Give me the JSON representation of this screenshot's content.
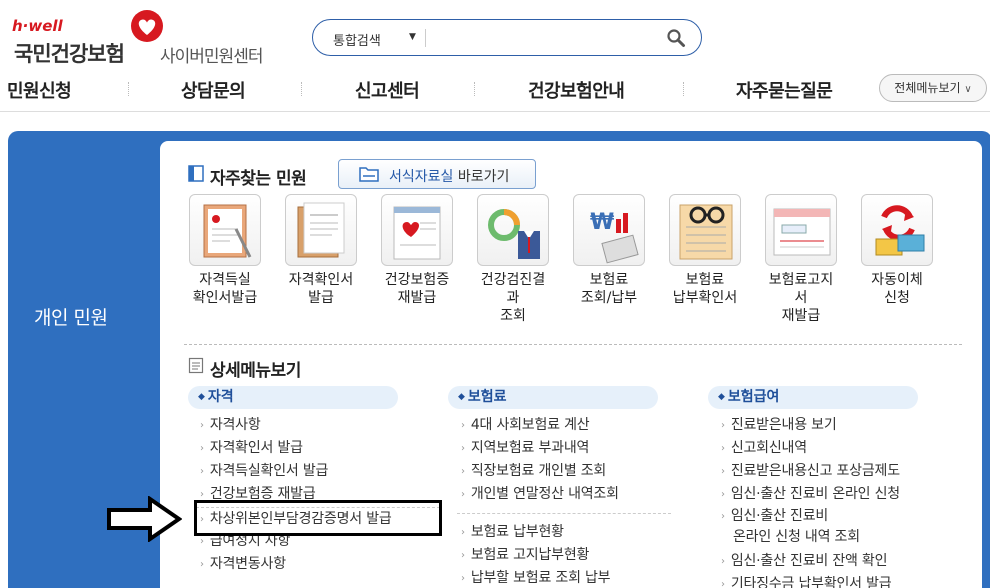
{
  "header": {
    "brand_hwell": "h·well",
    "brand_name": "국민건강보험",
    "brand_sub": "사이버민원센터",
    "search": {
      "scope": "통합검색",
      "value": ""
    }
  },
  "gnb": {
    "items": [
      "민원신청",
      "상담문의",
      "신고센터",
      "건강보험안내",
      "자주묻는질문"
    ],
    "all_menu": "전체메뉴보기"
  },
  "side_tab": {
    "label": "개인 민원"
  },
  "frequent": {
    "title": "자주찾는 민원",
    "form_button": {
      "highlight": "서식자료실",
      "rest": " 바로가기"
    },
    "tiles": [
      {
        "line1": "자격득실",
        "line2": "확인서발급",
        "line3": "",
        "icon": "document-pen-icon"
      },
      {
        "line1": "자격확인서",
        "line2": "발급",
        "line3": "",
        "icon": "clipboard-document-icon"
      },
      {
        "line1": "건강보험증",
        "line2": "재발급",
        "line3": "",
        "icon": "insurance-card-icon"
      },
      {
        "line1": "건강검진결",
        "line2": "과",
        "line3": "조회",
        "icon": "health-checkup-chart-icon"
      },
      {
        "line1": "보험료",
        "line2": "조회/납부",
        "line3": "",
        "icon": "won-chart-icon"
      },
      {
        "line1": "보험료",
        "line2": "납부확인서",
        "line3": "",
        "icon": "glasses-ledger-icon"
      },
      {
        "line1": "보험료고지",
        "line2": "서",
        "line3": "재발급",
        "icon": "bill-notice-icon"
      },
      {
        "line1": "자동이체",
        "line2": "신청",
        "line3": "",
        "icon": "auto-transfer-icon"
      }
    ]
  },
  "detail": {
    "title": "상세메뉴보기",
    "columns": [
      {
        "category": "자격",
        "links": [
          "자격사항",
          "자격확인서 발급",
          "자격득실확인서 발급",
          "건강보험증 재발급",
          "차상위본인부담경감증명서 발급",
          "급여정지 사항",
          "자격변동사항"
        ]
      },
      {
        "category": "보험료",
        "links": [
          "4대 사회보험료 계산",
          "지역보험료 부과내역",
          "직장보험료 개인별 조회",
          "개인별 연말정산 내역조회",
          "보험료 납부현황",
          "보험료 고지납부현황",
          "납부할 보험료 조회 납부"
        ]
      },
      {
        "category": "보험급여",
        "links": [
          "진료받은내용 보기",
          "신고회신내역",
          "진료받은내용신고 포상금제도",
          "임신·출산 진료비 온라인 신청",
          "임신·출산 진료비",
          "온라인 신청 내역 조회",
          "임신·출산 진료비 잔액 확인",
          "기타징수금 납부확인서 발급"
        ]
      }
    ]
  },
  "colors": {
    "accent": "#2f6fbf",
    "brand_red": "#d71920",
    "category_bg": "#e6f0fa"
  }
}
